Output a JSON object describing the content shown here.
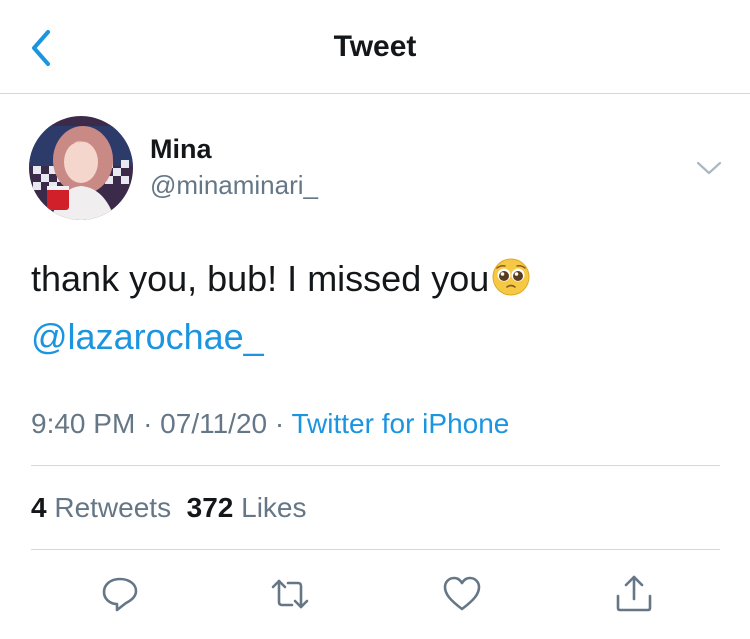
{
  "nav": {
    "title": "Tweet"
  },
  "author": {
    "name": "Mina",
    "handle": "@minaminari_"
  },
  "tweet": {
    "text": "thank you, bub! I missed you",
    "emoji": "pleading-face",
    "mention": "@lazarochae_"
  },
  "meta": {
    "time": "9:40 PM",
    "date": "07/11/20",
    "separator": "·",
    "source": "Twitter for iPhone"
  },
  "stats": {
    "retweets_count": "4",
    "retweets_label": "Retweets",
    "likes_count": "372",
    "likes_label": "Likes"
  },
  "actions": [
    "reply-icon",
    "retweet-icon",
    "like-icon",
    "share-icon"
  ],
  "colors": {
    "accent": "#1b95e0",
    "text": "#14171a",
    "secondary": "#657786",
    "divider": "#d6d9db"
  }
}
